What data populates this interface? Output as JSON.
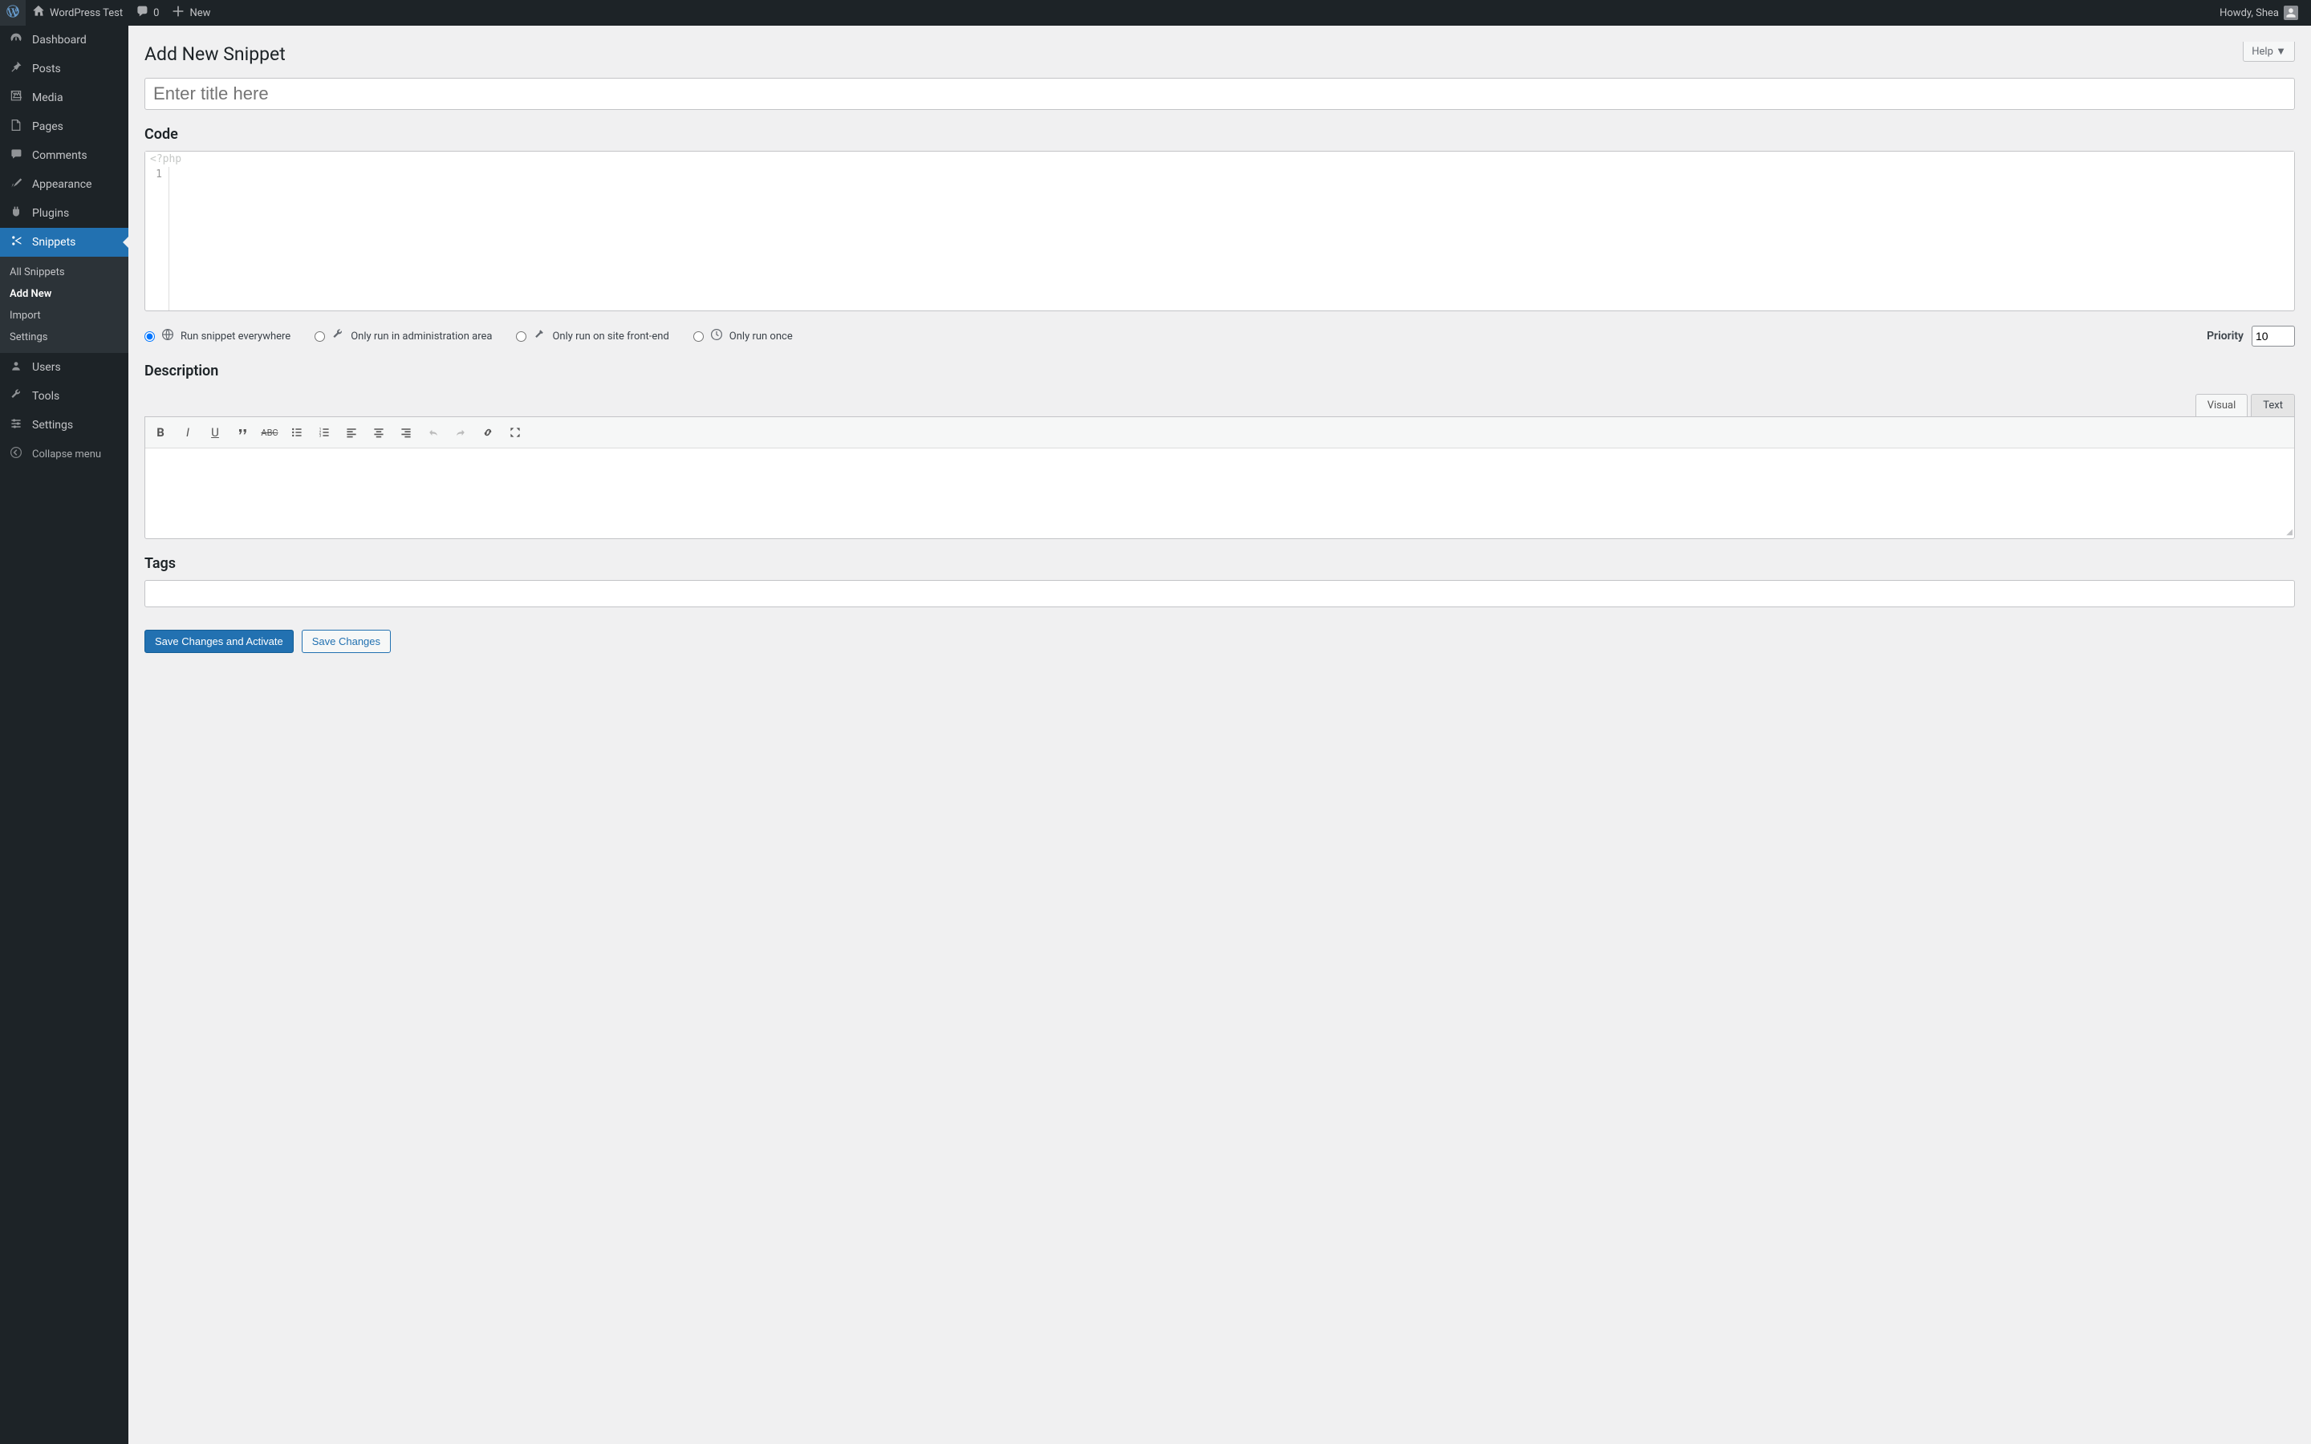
{
  "adminbar": {
    "site_name": "WordPress Test",
    "comments_count": "0",
    "new_label": "New",
    "greeting": "Howdy, Shea"
  },
  "sidebar": {
    "items": [
      {
        "label": "Dashboard"
      },
      {
        "label": "Posts"
      },
      {
        "label": "Media"
      },
      {
        "label": "Pages"
      },
      {
        "label": "Comments"
      },
      {
        "label": "Appearance"
      },
      {
        "label": "Plugins"
      },
      {
        "label": "Snippets"
      },
      {
        "label": "Users"
      },
      {
        "label": "Tools"
      },
      {
        "label": "Settings"
      }
    ],
    "submenu": [
      {
        "label": "All Snippets"
      },
      {
        "label": "Add New"
      },
      {
        "label": "Import"
      },
      {
        "label": "Settings"
      }
    ],
    "collapse_label": "Collapse menu"
  },
  "page": {
    "title": "Add New Snippet",
    "help_label": "Help ▼",
    "title_placeholder": "Enter title here",
    "code_heading": "Code",
    "code_hint": "<?php",
    "code_line": "1",
    "scope_options": [
      "Run snippet everywhere",
      "Only run in administration area",
      "Only run on site front-end",
      "Only run once"
    ],
    "priority_label": "Priority",
    "priority_value": "10",
    "description_heading": "Description",
    "visual_tab": "Visual",
    "text_tab": "Text",
    "tags_heading": "Tags",
    "save_activate_label": "Save Changes and Activate",
    "save_label": "Save Changes"
  }
}
